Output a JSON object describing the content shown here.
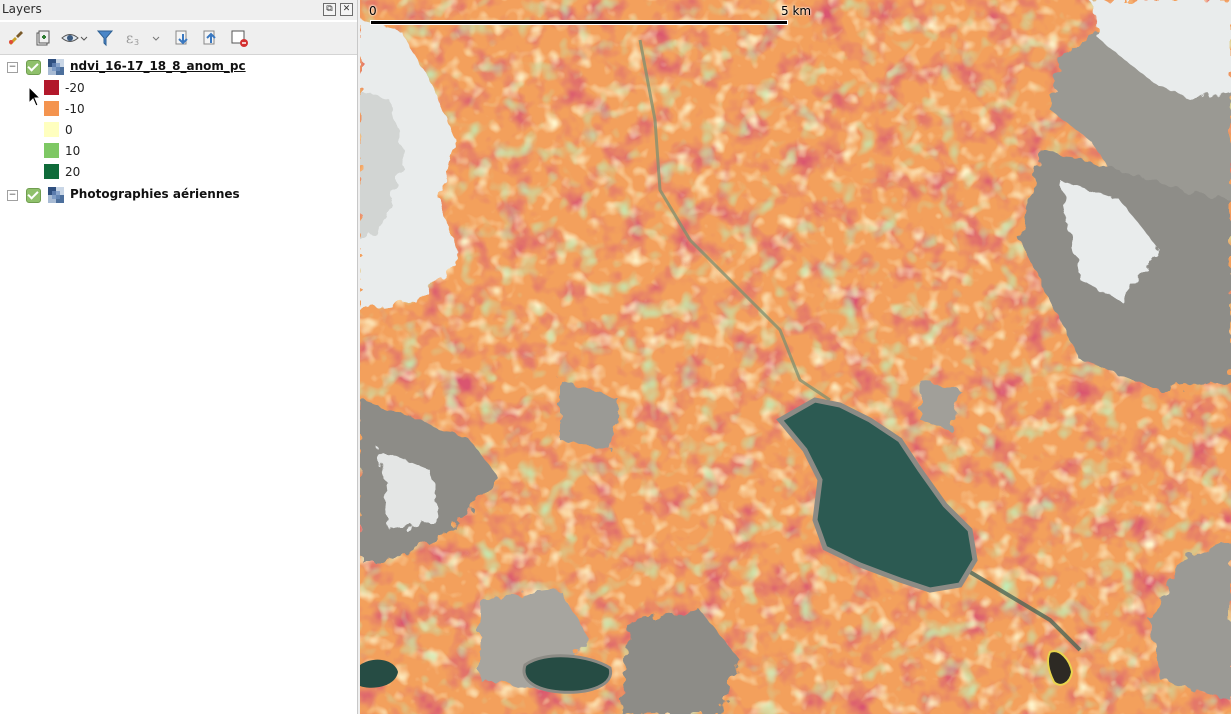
{
  "panel": {
    "title": "Layers",
    "toolbar_icons": [
      "style-paint-icon",
      "add-group-icon",
      "visibility-eye-icon",
      "filter-icon",
      "expression-filter-icon",
      "expand-all-icon",
      "collapse-all-icon",
      "remove-layer-icon"
    ]
  },
  "layers": [
    {
      "name": "ndvi_16-17_18_8_anom_pc",
      "checked": true,
      "expanded": true,
      "legend": [
        {
          "label": "-20",
          "color": "#b2182b"
        },
        {
          "label": "-10",
          "color": "#f4944f"
        },
        {
          "label": "0",
          "color": "#ffffbf"
        },
        {
          "label": "10",
          "color": "#7ec864"
        },
        {
          "label": "20",
          "color": "#0f6b3a"
        }
      ]
    },
    {
      "name": "Photographies aériennes",
      "checked": true,
      "expanded": false
    }
  ],
  "map": {
    "scalebar": {
      "start_label": "0",
      "end_label": "5 km"
    },
    "colors": {
      "lake": "#2c5a52",
      "snow": "#e9ecec",
      "rock": "#8d8c87"
    }
  }
}
